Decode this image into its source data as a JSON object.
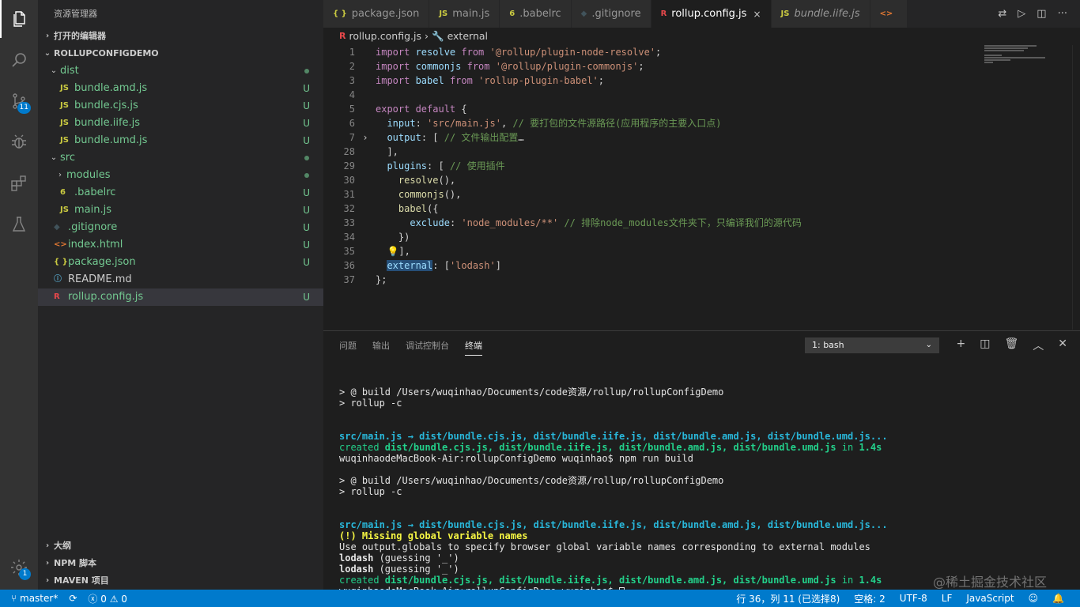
{
  "sidebar": {
    "title": "资源管理器",
    "open_editors": "打开的编辑器",
    "project": "ROLLUPCONFIGDEMO",
    "tree": [
      {
        "name": "dist",
        "kind": "folder-open",
        "indent": 1,
        "status": "dot"
      },
      {
        "name": "bundle.amd.js",
        "kind": "js",
        "indent": 2,
        "status": "U"
      },
      {
        "name": "bundle.cjs.js",
        "kind": "js",
        "indent": 2,
        "status": "U"
      },
      {
        "name": "bundle.iife.js",
        "kind": "js",
        "indent": 2,
        "status": "U"
      },
      {
        "name": "bundle.umd.js",
        "kind": "js",
        "indent": 2,
        "status": "U"
      },
      {
        "name": "src",
        "kind": "folder-open",
        "indent": 1,
        "status": "dot"
      },
      {
        "name": "modules",
        "kind": "folder-closed",
        "indent": 2,
        "status": "dot"
      },
      {
        "name": ".babelrc",
        "kind": "babel",
        "indent": 2,
        "status": "U"
      },
      {
        "name": "main.js",
        "kind": "js",
        "indent": 2,
        "status": "U"
      },
      {
        "name": ".gitignore",
        "kind": "git",
        "indent": 1,
        "status": "U"
      },
      {
        "name": "index.html",
        "kind": "html",
        "indent": 1,
        "status": "U"
      },
      {
        "name": "package.json",
        "kind": "json",
        "indent": 1,
        "status": "U"
      },
      {
        "name": "README.md",
        "kind": "info",
        "indent": 1,
        "status": ""
      },
      {
        "name": "rollup.config.js",
        "kind": "rollup",
        "indent": 1,
        "status": "U",
        "selected": true
      }
    ],
    "bottom_sections": [
      "大纲",
      "NPM 脚本",
      "MAVEN 项目"
    ]
  },
  "activity_badges": {
    "scm": "11",
    "settings": "1"
  },
  "tabs": [
    {
      "label": "package.json",
      "icon": "{ }",
      "icon_color": "#cbcb41"
    },
    {
      "label": "main.js",
      "icon": "JS",
      "icon_color": "#cbcb41"
    },
    {
      "label": ".babelrc",
      "icon": "6",
      "icon_color": "#cbcb41"
    },
    {
      "label": ".gitignore",
      "icon": "◆",
      "icon_color": "#41535b"
    },
    {
      "label": "rollup.config.js",
      "icon": "R",
      "icon_color": "#e8484b",
      "active": true,
      "close": "×"
    },
    {
      "label": "bundle.iife.js",
      "icon": "JS",
      "icon_color": "#cbcb41",
      "italic": true
    },
    {
      "label": "",
      "icon": "<>",
      "icon_color": "#e37933"
    }
  ],
  "breadcrumb": {
    "file": "rollup.config.js",
    "separator": "›",
    "symbol": "external"
  },
  "editor": {
    "lines": [
      {
        "n": "1",
        "fold": "",
        "tokens": [
          [
            "kc",
            "import "
          ],
          [
            "prop",
            "resolve "
          ],
          [
            "kc",
            "from "
          ],
          [
            "str",
            "'@rollup/plugin-node-resolve'"
          ],
          [
            "",
            "; "
          ]
        ]
      },
      {
        "n": "2",
        "fold": "",
        "tokens": [
          [
            "kc",
            "import "
          ],
          [
            "prop",
            "commonjs "
          ],
          [
            "kc",
            "from "
          ],
          [
            "str",
            "'@rollup/plugin-commonjs'"
          ],
          [
            "",
            ";"
          ]
        ]
      },
      {
        "n": "3",
        "fold": "",
        "tokens": [
          [
            "kc",
            "import "
          ],
          [
            "prop",
            "babel "
          ],
          [
            "kc",
            "from "
          ],
          [
            "str",
            "'rollup-plugin-babel'"
          ],
          [
            "",
            ";"
          ]
        ]
      },
      {
        "n": "4",
        "fold": "",
        "tokens": []
      },
      {
        "n": "5",
        "fold": "",
        "tokens": [
          [
            "kc",
            "export "
          ],
          [
            "kc",
            "default "
          ],
          [
            "",
            "{"
          ]
        ]
      },
      {
        "n": "6",
        "fold": "",
        "tokens": [
          [
            "",
            "  "
          ],
          [
            "prop",
            "input"
          ],
          [
            "",
            ": "
          ],
          [
            "str",
            "'src/main.js'"
          ],
          [
            "",
            ", "
          ],
          [
            "cm",
            "// 要打包的文件源路径(应用程序的主要入口点)"
          ]
        ]
      },
      {
        "n": "7",
        "fold": "›",
        "tokens": [
          [
            "",
            "  "
          ],
          [
            "prop",
            "output"
          ],
          [
            "",
            ": [ "
          ],
          [
            "cm",
            "// 文件输出配置"
          ],
          [
            "",
            "…"
          ]
        ]
      },
      {
        "n": "28",
        "fold": "",
        "tokens": [
          [
            "",
            "  ],"
          ]
        ]
      },
      {
        "n": "29",
        "fold": "",
        "tokens": [
          [
            "",
            "  "
          ],
          [
            "prop",
            "plugins"
          ],
          [
            "",
            ": [ "
          ],
          [
            "cm",
            "// 使用插件"
          ]
        ]
      },
      {
        "n": "30",
        "fold": "",
        "tokens": [
          [
            "",
            "    "
          ],
          [
            "fn",
            "resolve"
          ],
          [
            "",
            "(),"
          ]
        ]
      },
      {
        "n": "31",
        "fold": "",
        "tokens": [
          [
            "",
            "    "
          ],
          [
            "fn",
            "commonjs"
          ],
          [
            "",
            "(),"
          ]
        ]
      },
      {
        "n": "32",
        "fold": "",
        "tokens": [
          [
            "",
            "    "
          ],
          [
            "fn",
            "babel"
          ],
          [
            "",
            "({"
          ]
        ]
      },
      {
        "n": "33",
        "fold": "",
        "tokens": [
          [
            "",
            "      "
          ],
          [
            "prop",
            "exclude"
          ],
          [
            "",
            ": "
          ],
          [
            "str",
            "'node_modules/**'"
          ],
          [
            "",
            " "
          ],
          [
            "cm",
            "// 排除node_modules文件夹下，只编译我们的源代码"
          ]
        ]
      },
      {
        "n": "34",
        "fold": "",
        "tokens": [
          [
            "",
            "    })"
          ]
        ]
      },
      {
        "n": "35",
        "fold": "",
        "tokens": [
          [
            "",
            "  💡],"
          ]
        ]
      },
      {
        "n": "36",
        "fold": "",
        "tokens": [
          [
            "",
            "  "
          ],
          [
            "prop hl",
            "external"
          ],
          [
            "",
            ": ["
          ],
          [
            "str",
            "'lodash'"
          ],
          [
            "",
            "]"
          ]
        ]
      },
      {
        "n": "37",
        "fold": "",
        "tokens": [
          [
            "",
            "};"
          ]
        ]
      }
    ]
  },
  "panel": {
    "tabs": [
      "问题",
      "输出",
      "调试控制台",
      "终端"
    ],
    "active_tab": "终端",
    "terminal_select": "1: bash",
    "terminal_lines": [
      [],
      [
        [
          "",
          "> @ build /Users/wuqinhao/Documents/code资源/rollup/rollupConfigDemo"
        ]
      ],
      [
        [
          "",
          "> rollup -c"
        ]
      ],
      [],
      [],
      [
        [
          "t-cyan",
          "src/main.js → dist/bundle.cjs.js, dist/bundle.iife.js, dist/bundle.amd.js, dist/bundle.umd.js..."
        ]
      ],
      [
        [
          "t-green",
          "created "
        ],
        [
          "t-greenb",
          "dist/bundle.cjs.js, dist/bundle.iife.js, dist/bundle.amd.js, dist/bundle.umd.js"
        ],
        [
          "t-green",
          " in "
        ],
        [
          "t-greenb",
          "1.4s"
        ]
      ],
      [
        [
          "",
          "wuqinhaodeMacBook-Air:rollupConfigDemo wuqinhao$ npm run build"
        ]
      ],
      [],
      [
        [
          "",
          "> @ build /Users/wuqinhao/Documents/code资源/rollup/rollupConfigDemo"
        ]
      ],
      [
        [
          "",
          "> rollup -c"
        ]
      ],
      [],
      [],
      [
        [
          "t-cyan",
          "src/main.js → dist/bundle.cjs.js, dist/bundle.iife.js, dist/bundle.amd.js, dist/bundle.umd.js..."
        ]
      ],
      [
        [
          "t-yellow",
          "(!) Missing global variable names"
        ]
      ],
      [
        [
          "",
          "Use output.globals to specify browser global variable names corresponding to external modules"
        ]
      ],
      [
        [
          "t-bold",
          "lodash"
        ],
        [
          "",
          " (guessing '_')"
        ]
      ],
      [
        [
          "t-bold",
          "lodash"
        ],
        [
          "",
          " (guessing '_')"
        ]
      ],
      [
        [
          "t-green",
          "created "
        ],
        [
          "t-greenb",
          "dist/bundle.cjs.js, dist/bundle.iife.js, dist/bundle.amd.js, dist/bundle.umd.js"
        ],
        [
          "t-green",
          " in "
        ],
        [
          "t-greenb",
          "1.4s"
        ]
      ],
      [
        [
          "",
          "wuqinhaodeMacBook-Air:rollupConfigDemo wuqinhao$ "
        ],
        [
          "cursor",
          ""
        ]
      ]
    ]
  },
  "watermark": "@稀土掘金技术社区",
  "statusbar": {
    "branch": "master*",
    "errors": "0",
    "warnings": "0",
    "position": "行 36，列 11 (已选择8)",
    "spaces": "空格: 2",
    "encoding": "UTF-8",
    "eol": "LF",
    "language": "JavaScript"
  }
}
